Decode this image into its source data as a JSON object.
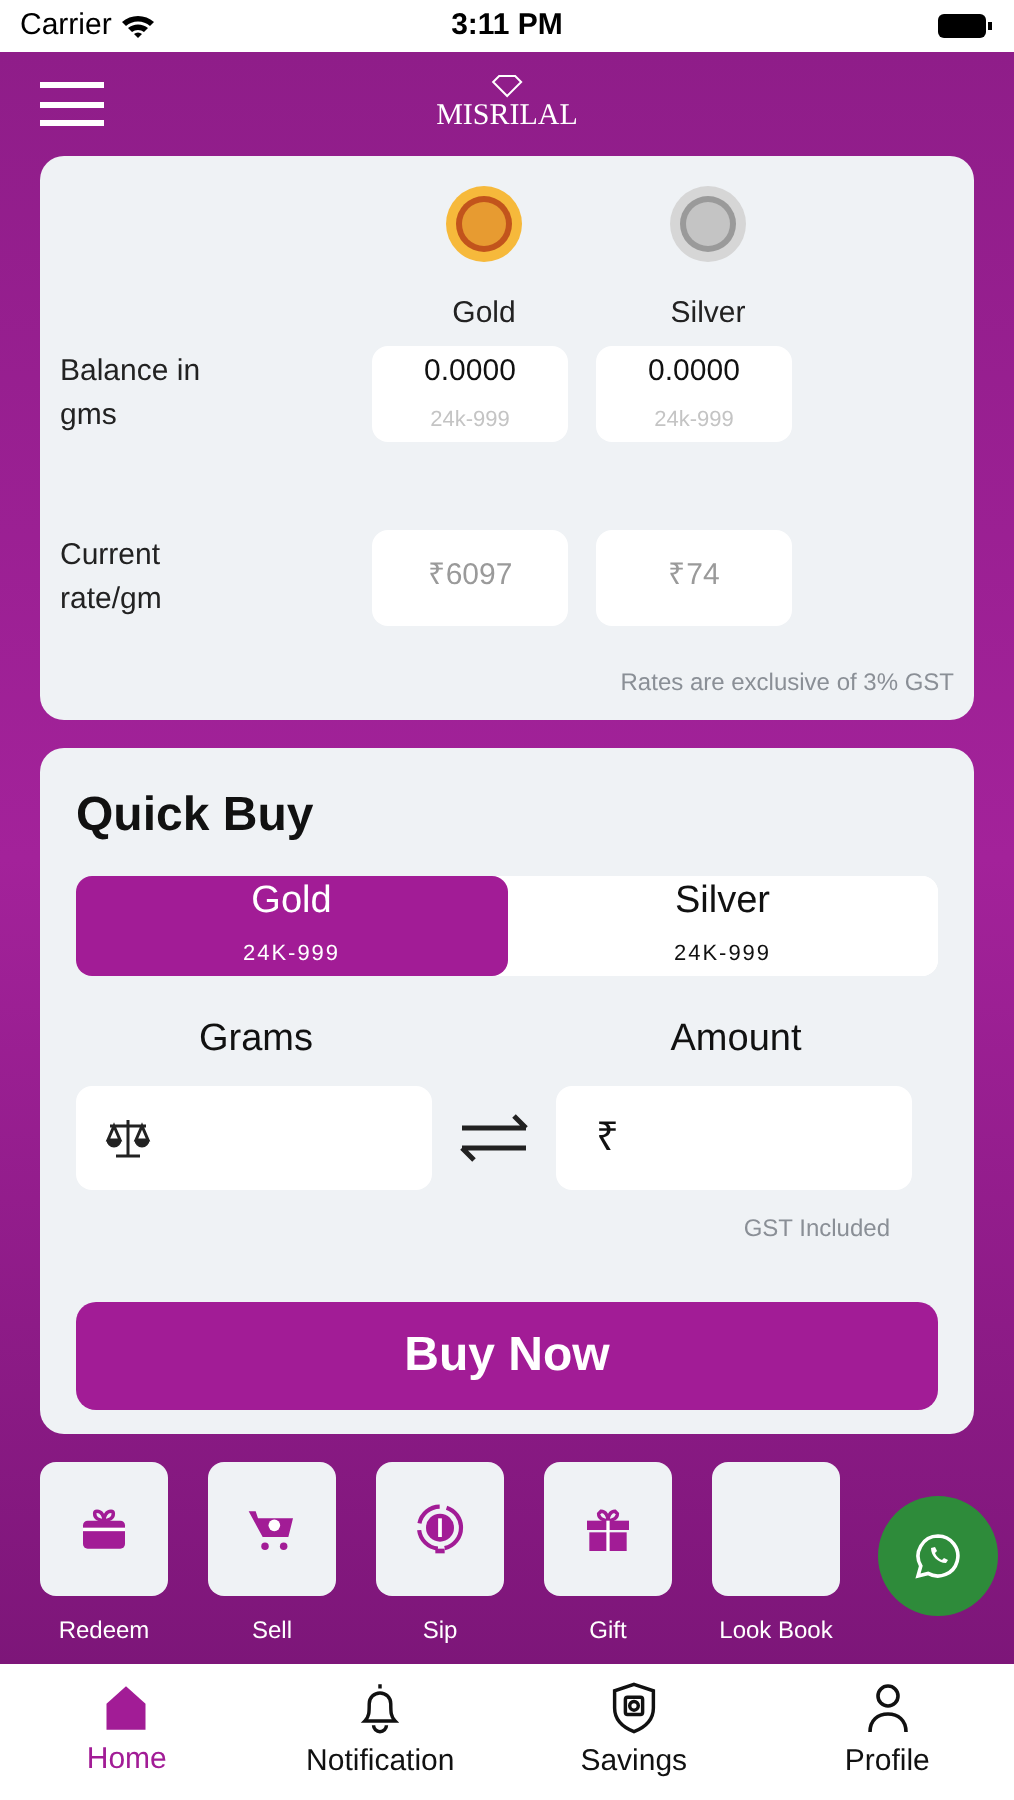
{
  "status_bar": {
    "carrier": "Carrier",
    "time": "3:11 PM"
  },
  "header": {
    "logo": "MISRILAL"
  },
  "holdings": {
    "columns": [
      {
        "label": "Gold",
        "kind": "gold"
      },
      {
        "label": "Silver",
        "kind": "silver"
      }
    ],
    "balance_label": "Balance in gms",
    "balances": [
      {
        "value": "0.0000",
        "purity": "24k-999"
      },
      {
        "value": "0.0000",
        "purity": "24k-999"
      }
    ],
    "rate_label": "Current rate/gm",
    "rates": [
      "₹6097",
      "₹74"
    ],
    "note": "Rates are exclusive of 3% GST"
  },
  "quick_buy": {
    "title": "Quick Buy",
    "tabs": [
      {
        "label": "Gold",
        "purity": "24K-999",
        "selected": true
      },
      {
        "label": "Silver",
        "purity": "24K-999",
        "selected": false
      }
    ],
    "grams_label": "Grams",
    "amount_label": "Amount",
    "currency": "₹",
    "gst_note": "GST Included",
    "button": "Buy Now"
  },
  "actions": [
    {
      "label": "Redeem",
      "kind": "redeem"
    },
    {
      "label": "Sell",
      "kind": "sell"
    },
    {
      "label": "Sip",
      "kind": "sip"
    },
    {
      "label": "Gift",
      "kind": "gift"
    },
    {
      "label": "Look Book",
      "kind": "lookbook"
    }
  ],
  "nav": [
    {
      "label": "Home",
      "kind": "home",
      "selected": true
    },
    {
      "label": "Notification",
      "kind": "bell",
      "selected": false
    },
    {
      "label": "Savings",
      "kind": "savings",
      "selected": false
    },
    {
      "label": "Profile",
      "kind": "profile",
      "selected": false
    }
  ]
}
